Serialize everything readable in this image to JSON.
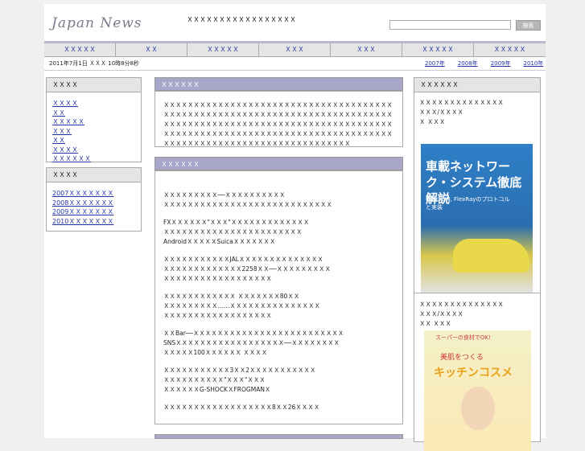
{
  "header": {
    "logo": "Japan News",
    "tagline": "ＸＸＸＸＸＸＸＸＸＸＸＸＸＸＸＸＸ",
    "search_placeholder": "",
    "search_button": "検索"
  },
  "nav": [
    "ＸＸＸＸＸ",
    "ＸＸ",
    "ＸＸＸＸＸ",
    "ＸＸＸ",
    "ＸＸＸ",
    "ＸＸＸＸＸ",
    "ＸＸＸＸＸ"
  ],
  "datebar": {
    "date": "2011年7月1日 ＸＸＸ 10時8分8秒",
    "years": [
      "2007年",
      "2008年",
      "2009年",
      "2010年"
    ]
  },
  "left": {
    "category_title": "ＸＸＸＸ",
    "categories": [
      "ＸＸＸＸ",
      "ＸＸ",
      "ＸＸＸＸＸ",
      "ＸＸＸ",
      "ＸＸ",
      "ＸＸＸＸ",
      "ＸＸＸＸＸＸ"
    ],
    "archive_title": "ＸＸＸＸ",
    "archives": [
      "2007ＸＸＸＸＸＸＸ",
      "2008ＸＸＸＸＸＸＸ",
      "2009ＸＸＸＸＸＸＸ",
      "2010ＸＸＸＸＸＸＸ"
    ]
  },
  "center": {
    "section1_title": "ＸＸＸＸＸＸ",
    "section1_text": "ＸＸＸＸＸＸＸＸＸＸＸＸＸＸＸＸＸＸＸＸＸＸＸＸＸＸＸＸＸＸＸＸＸＸＸＸＸＸＸＸＸＸＸＸＸＸＸＸＸＸＸＸＸＸＸＸＸＸＸＸＸＸＸＸＸＸＸＸＸＸＸＸＸＸＸＸＸＸＸＸＸＸＸＸＸＸＸＸＸＸＸＸＸＸＸＸＸＸＸＸＸＸＸＸＸＸＸＸＸＸＸＸＸＸＸＸＸＸＸＸＸＸＸＸＸＸＸＸＸＸＸＸＸＸＸＸＸＸＸＸＸＸＸＸＸＸＸＸＸＸＸＸＸＸＸＸＸＸＸＸＸＸＸＸＸＸＸＸＸＸＸＸＸＸＸＸＸＸＸＸＸＸＸ",
    "section2_title": "ＸＸＸＸＸＸ",
    "news_lines": [
      "ＸＸＸＸＸＸＸＸＸ──ＸＸＸＸＸＸＸＸＸＸ",
      "ＸＸＸＸＸＸＸＸＸＸＸＸＸＸＸＸＸＸＸＸＸＸＸＸＸＸＸＸ",
      "",
      "FXＸＸＸＸＸＸ\"ＸＸＸ\"ＸＸＸＸＸＸＸＸＸＸＸＸＸ",
      "ＸＸＸＸＸＸＸＸＸＸＸＸＸＸＸＸＸＸＸＸＸＸＸ",
      "AndroidＸＸＸＸＸSuicaＸＸＸＸＸＸＸ",
      "",
      "ＸＸＸＸＸＸＸＸＸＸＸJALＸＸＸＸＸＸＸＸＸＸＸＸＸＸ",
      "ＸＸＸＸＸＸＸＸＸＸＸＸＸ2258ＸＸ──ＸＸＸＸＸＸＸＸＸ",
      "ＸＸＸＸＸＸＸＸＸＸＸＸＸＸＸＸＸＸ",
      "",
      "ＸＸＸＸＸＸＸＸＸＸＸＸ ＸＸＸＸＸＸＸ80ＸＸ",
      "ＸＸＸＸＸＸＸＸＸ……ＸＸＸＸＸＸＸＸＸＸＸＸＸＸＸ",
      "ＸＸＸＸＸＸＸＸＸＸＸＸＸＸＸＸＸＸ",
      "",
      "ＸＸBar──ＸＸＸＸＸＸＸＸＸＸＸＸＸＸＸＸＸＸＸＸＸＸＸＸＸ",
      "SNSＸＸＸＸＸＸＸＸＸＸＸＸＸＸＸＸＸＸ──ＸＸＸＸＸＸＸＸ",
      "ＸＸＸＸＸ100ＸＸＸＸＸＸ ＸＸＸＸ",
      "",
      "ＸＸＸＸＸＸＸＸＸＸＸ3ＸＸ2ＸＸＸＸＸＸＸＸＸＸＸ",
      "ＸＸＸＸＸＸＸＸＸＸ\"ＸＸＸ\"ＸＸＸ",
      "ＸＸＸＸＸＸG-SHOCKＸFROGMANＸ",
      "",
      "ＸＸＸＸＸＸＸＸＸＸＸＸＸＸＸＸＸＸ8ＸＸ26ＸＸＸＸ"
    ]
  },
  "right": {
    "title": "ＸＸＸＸＸＸ",
    "book1": [
      "ＸＸＸＸＸＸＸＸＸＸＸＸＸＸ",
      "ＸＸＸ/ＸＸＸＸ",
      "Ｘ ＸＸＸ"
    ],
    "book1_cover": {
      "title": "車載ネットワーク・システム徹底解説",
      "subtitle": "CAN, LIN, FlexRayのプロトコルと実装",
      "accent": "#2f7fc7"
    },
    "book2": [
      "ＸＸＸＸＸＸＸＸＸＸＸＸＸＸ",
      "ＸＸＸ/ＸＸＸＸ",
      "ＸＸ ＸＸＸ"
    ],
    "book2_cover": {
      "line": "スーパーの食材でOK!",
      "title1": "美肌をつくる",
      "title2": "キッチンコスメ",
      "accent": "#e9a21c"
    }
  }
}
